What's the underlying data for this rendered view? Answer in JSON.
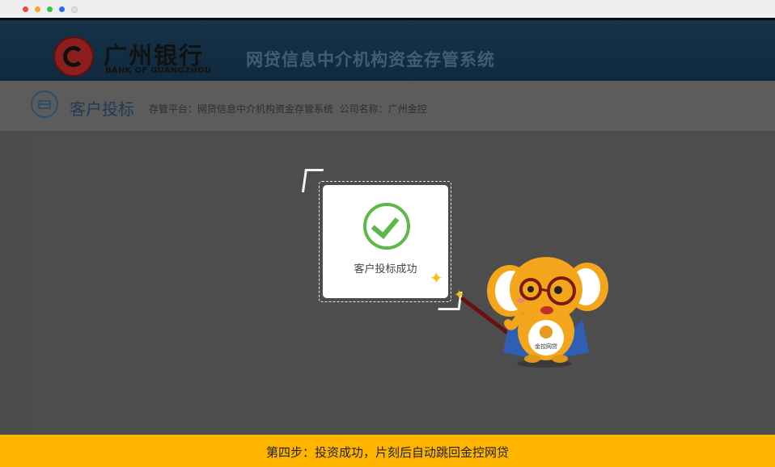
{
  "window": {
    "dots": [
      {
        "name": "close",
        "color": "#ee4444"
      },
      {
        "name": "minimize",
        "color": "#f5a623"
      },
      {
        "name": "zoom",
        "color": "#34c84a"
      },
      {
        "name": "extra",
        "color": "#2a6be0"
      },
      {
        "name": "extra2",
        "color": "#e0e0e0"
      }
    ]
  },
  "header": {
    "bank_name_cn": "广州银行",
    "bank_name_en": "BANK OF GUANGZHOU",
    "system_title": "网贷信息中介机构资金存管系统"
  },
  "subheader": {
    "page_title": "客户投标",
    "platform_label": "存管平台：",
    "platform_value": "网贷信息中介机构资金存管系统",
    "company_label": "公司名称：",
    "company_value": "广州金控"
  },
  "dialog": {
    "icon": "check-circle-icon",
    "message": "客户投标成功"
  },
  "mascot": {
    "badge_text": "金控网贷"
  },
  "footer": {
    "step_text": "第四步：投资成功，片刻后自动跳回金控网贷"
  },
  "colors": {
    "accent": "#ffb400",
    "success": "#5bb947",
    "header_bg": "#163248"
  }
}
